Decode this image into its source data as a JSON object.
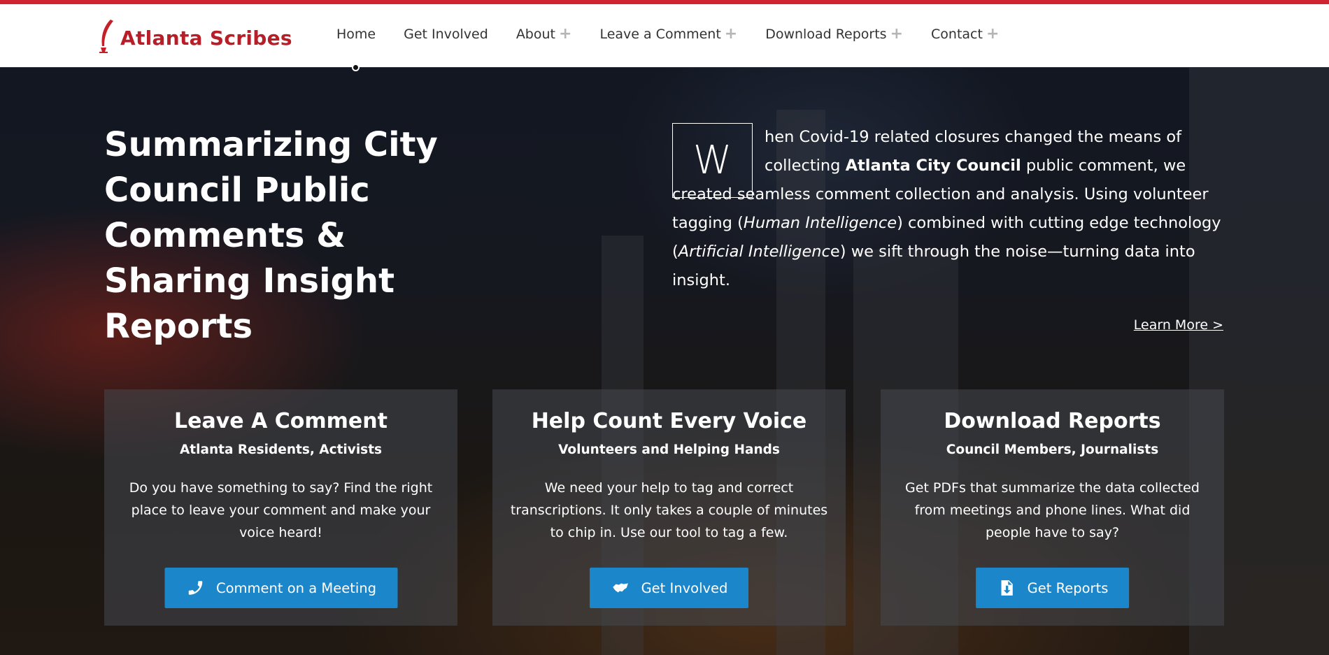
{
  "brand": {
    "name": "Atlanta Scribes",
    "color": "#b81e27",
    "icon": "quill-icon"
  },
  "nav": {
    "items": [
      {
        "label": "Home",
        "has_submenu": false,
        "active": true
      },
      {
        "label": "Get Involved",
        "has_submenu": false
      },
      {
        "label": "About",
        "has_submenu": true
      },
      {
        "label": "Leave a Comment",
        "has_submenu": true
      },
      {
        "label": "Download Reports",
        "has_submenu": true
      },
      {
        "label": "Contact",
        "has_submenu": true
      }
    ],
    "plus": "+"
  },
  "hero": {
    "headline": [
      "Summarizing City",
      "Council Public",
      "Comments &",
      "Sharing Insight Reports"
    ],
    "dropcap": "W",
    "intro": {
      "p1": "hen Covid-19 related closures changed the means of collecting ",
      "b1": "Atlanta City Council",
      "p2": " public comment, we created seamless comment collection and analysis. Using volunteer tagging (",
      "i1": "Human Intelligence",
      "p3": ") combined with cutting edge technology (",
      "i2": "Artificial Intelligenc",
      "p4": "e) we sift through the noise—turning data into insight."
    },
    "learn_more": "Learn More >"
  },
  "cards": [
    {
      "title": "Leave A Comment",
      "subtitle": "Atlanta Residents, Activists",
      "body": "Do you have something to say? Find the right place to leave your comment and make your voice heard!",
      "button": "Comment on a Meeting",
      "icon": "phone-icon"
    },
    {
      "title": "Help Count Every Voice",
      "subtitle": "Volunteers and Helping Hands",
      "body": "We need your help to tag and correct transcriptions.   It only takes a couple of minutes to chip in.  Use our tool to tag a few.",
      "button": "Get Involved",
      "icon": "handshake-icon"
    },
    {
      "title": "Download Reports",
      "subtitle": "Council Members, Journalists",
      "body": "Get PDFs that summarize the data collected from meetings and phone lines.  What did people have to say?",
      "button": "Get Reports",
      "icon": "file-download-icon"
    }
  ],
  "colors": {
    "accent": "#d02530",
    "button": "#1b86c9"
  }
}
